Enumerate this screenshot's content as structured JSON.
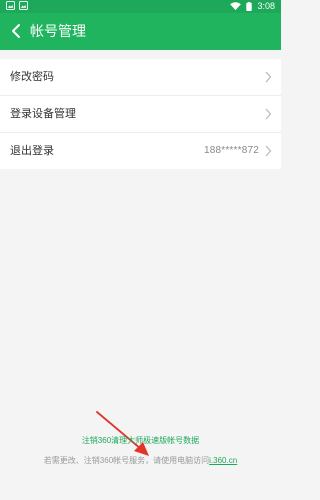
{
  "status_bar": {
    "time": "3:08",
    "left_icons": [
      "image-icon",
      "image-icon"
    ],
    "right_icons": [
      "wifi-icon",
      "battery-icon"
    ]
  },
  "header": {
    "title": "帐号管理",
    "back_icon": "back-arrow-icon",
    "bg_color": "#20b45f"
  },
  "settings": {
    "items": [
      {
        "label": "修改密码",
        "value": ""
      },
      {
        "label": "登录设备管理",
        "value": ""
      },
      {
        "label": "退出登录",
        "value": "188*****872"
      }
    ]
  },
  "footer": {
    "cancel_link": "注销360清理大师极速版帐号数据",
    "note_prefix": "若需更改、注销360帐号服务，请使用电脑访问",
    "note_link": "i.360.cn"
  },
  "colors": {
    "accent": "#1ea85a",
    "annotation_arrow": "#e0352b"
  }
}
